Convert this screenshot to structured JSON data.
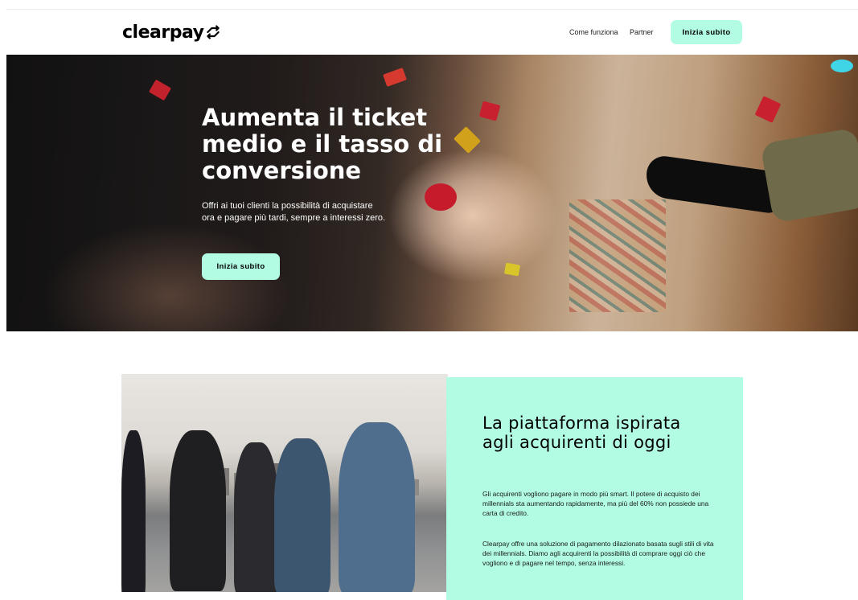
{
  "header": {
    "logo_text": "clearpay",
    "nav": [
      "Come funziona",
      "Partner"
    ],
    "cta_label": "Inizia subito"
  },
  "hero": {
    "title": "Aumenta il ticket medio e il tasso di conversione",
    "subtitle": "Offri ai tuoi clienti la possibilità di acquistare ora e pagare più tardi, sempre a interessi zero.",
    "cta_label": "Inizia subito"
  },
  "section": {
    "title": "La piattaforma ispirata agli acquirenti di oggi",
    "paragraph1": "Gli acquirenti vogliono pagare in modo più smart. Il potere di acquisto dei millennials sta aumentando rapidamente, ma più del 60% non possiede una carta di credito.",
    "paragraph2": "Clearpay offre una soluzione di pagamento dilazionato basata sugli stili di vita dei millennials. Diamo agli acquirenti la possibilità di comprare oggi ciò che vogliono e di pagare nel tempo, senza interessi."
  },
  "colors": {
    "accent": "#b2fce4",
    "text": "#000000",
    "hero_text": "#ffffff"
  },
  "icons": {
    "logo_mark": "clearpay-arrows-icon"
  }
}
